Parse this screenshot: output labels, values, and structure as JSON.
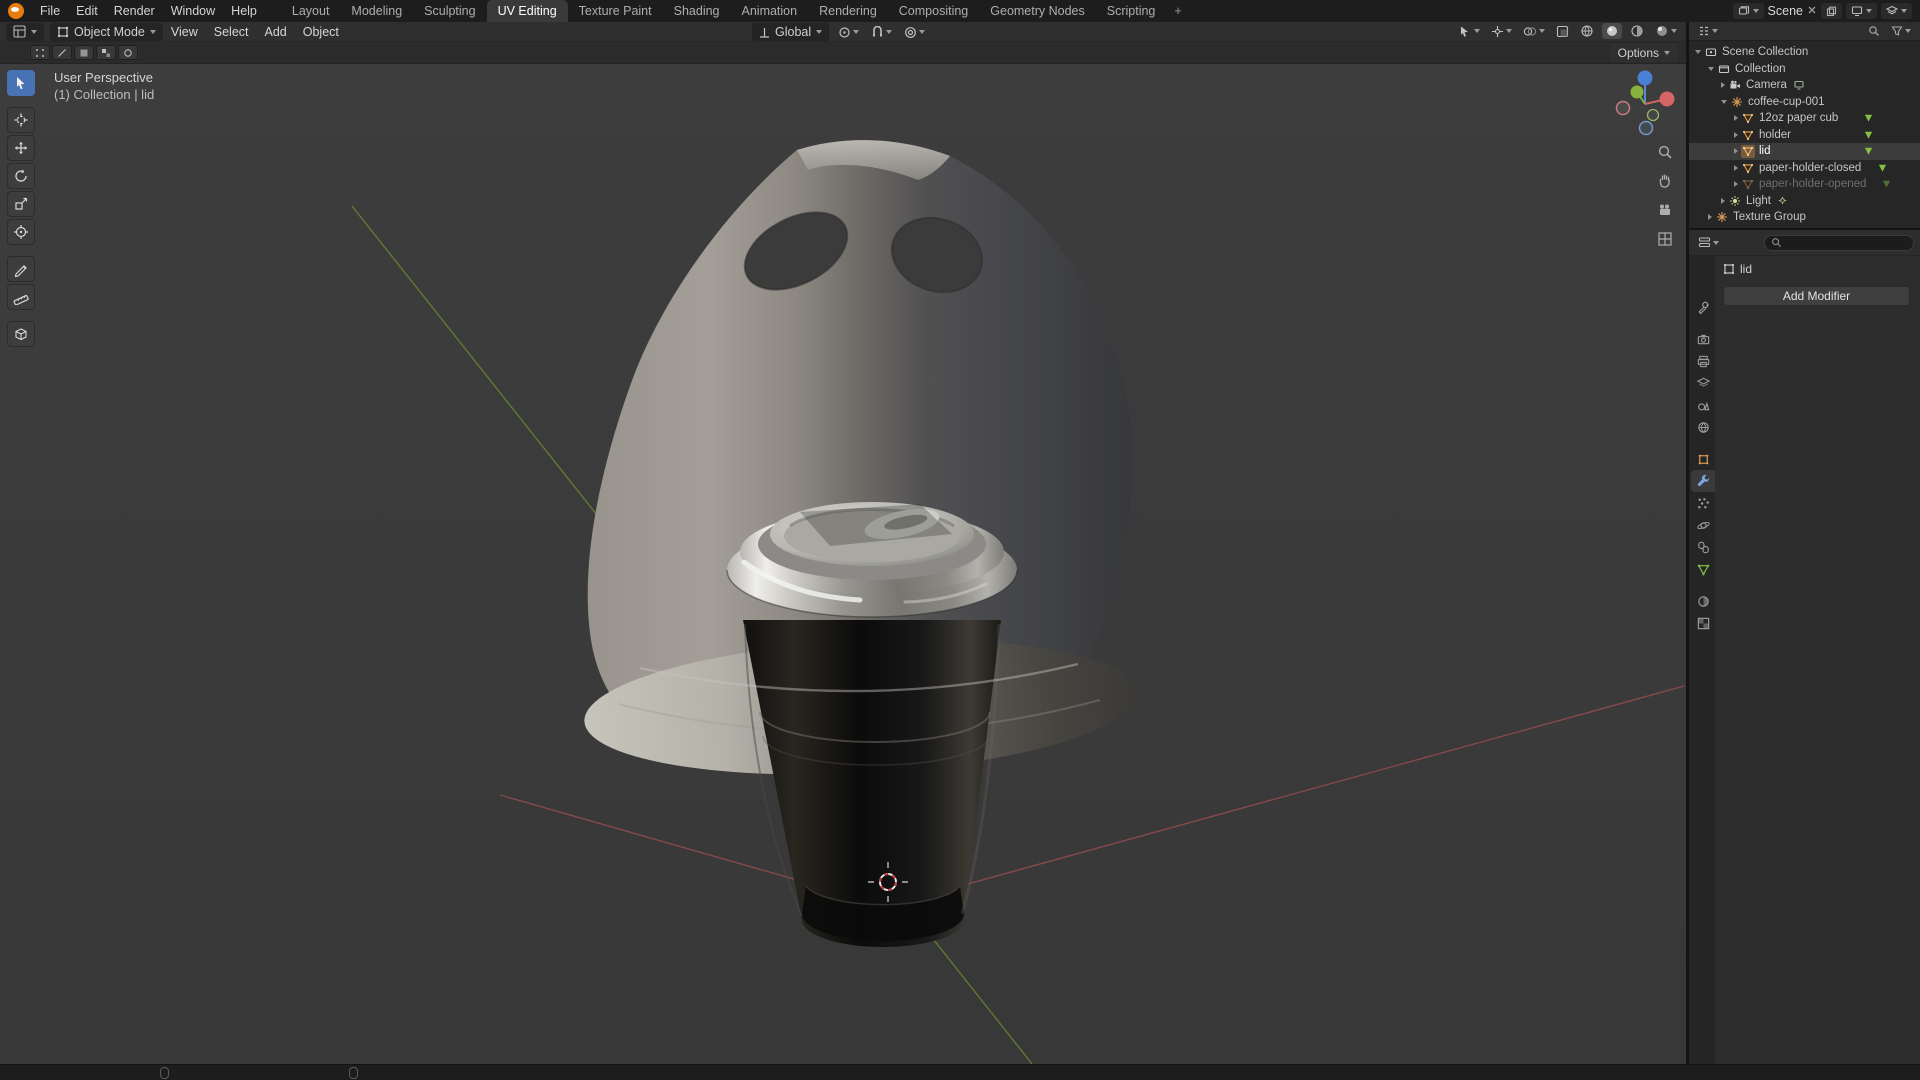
{
  "topbar": {
    "app_menus": [
      "File",
      "Edit",
      "Render",
      "Window",
      "Help"
    ],
    "workspaces": [
      "Layout",
      "Modeling",
      "Sculpting",
      "UV Editing",
      "Texture Paint",
      "Shading",
      "Animation",
      "Rendering",
      "Compositing",
      "Geometry Nodes",
      "Scripting"
    ],
    "active_workspace": "UV Editing",
    "add_workspace_label": "+",
    "scene_label": "Scene"
  },
  "viewport_header": {
    "mode": "Object Mode",
    "menus": [
      "View",
      "Select",
      "Add",
      "Object"
    ],
    "orientation": "Global",
    "options_label": "Options"
  },
  "viewport_overlay": {
    "line1": "User Perspective",
    "line2": "(1) Collection | lid"
  },
  "outliner": {
    "rows": [
      {
        "label": "Scene Collection"
      },
      {
        "label": "Collection"
      },
      {
        "label": "Camera"
      },
      {
        "label": "coffee-cup-001"
      },
      {
        "label": "12oz paper cub"
      },
      {
        "label": "holder"
      },
      {
        "label": "lid"
      },
      {
        "label": "paper-holder-closed"
      },
      {
        "label": "paper-holder-opened"
      },
      {
        "label": "Light"
      },
      {
        "label": "Texture Group"
      }
    ]
  },
  "properties": {
    "breadcrumb_object": "lid",
    "add_modifier_label": "Add Modifier"
  },
  "colors": {
    "accent_blue": "#4772b3",
    "object_orange": "#e0973f",
    "mesh_data_green": "#84c043",
    "axis_red": "#a24d52",
    "axis_green": "#6b8f33"
  }
}
